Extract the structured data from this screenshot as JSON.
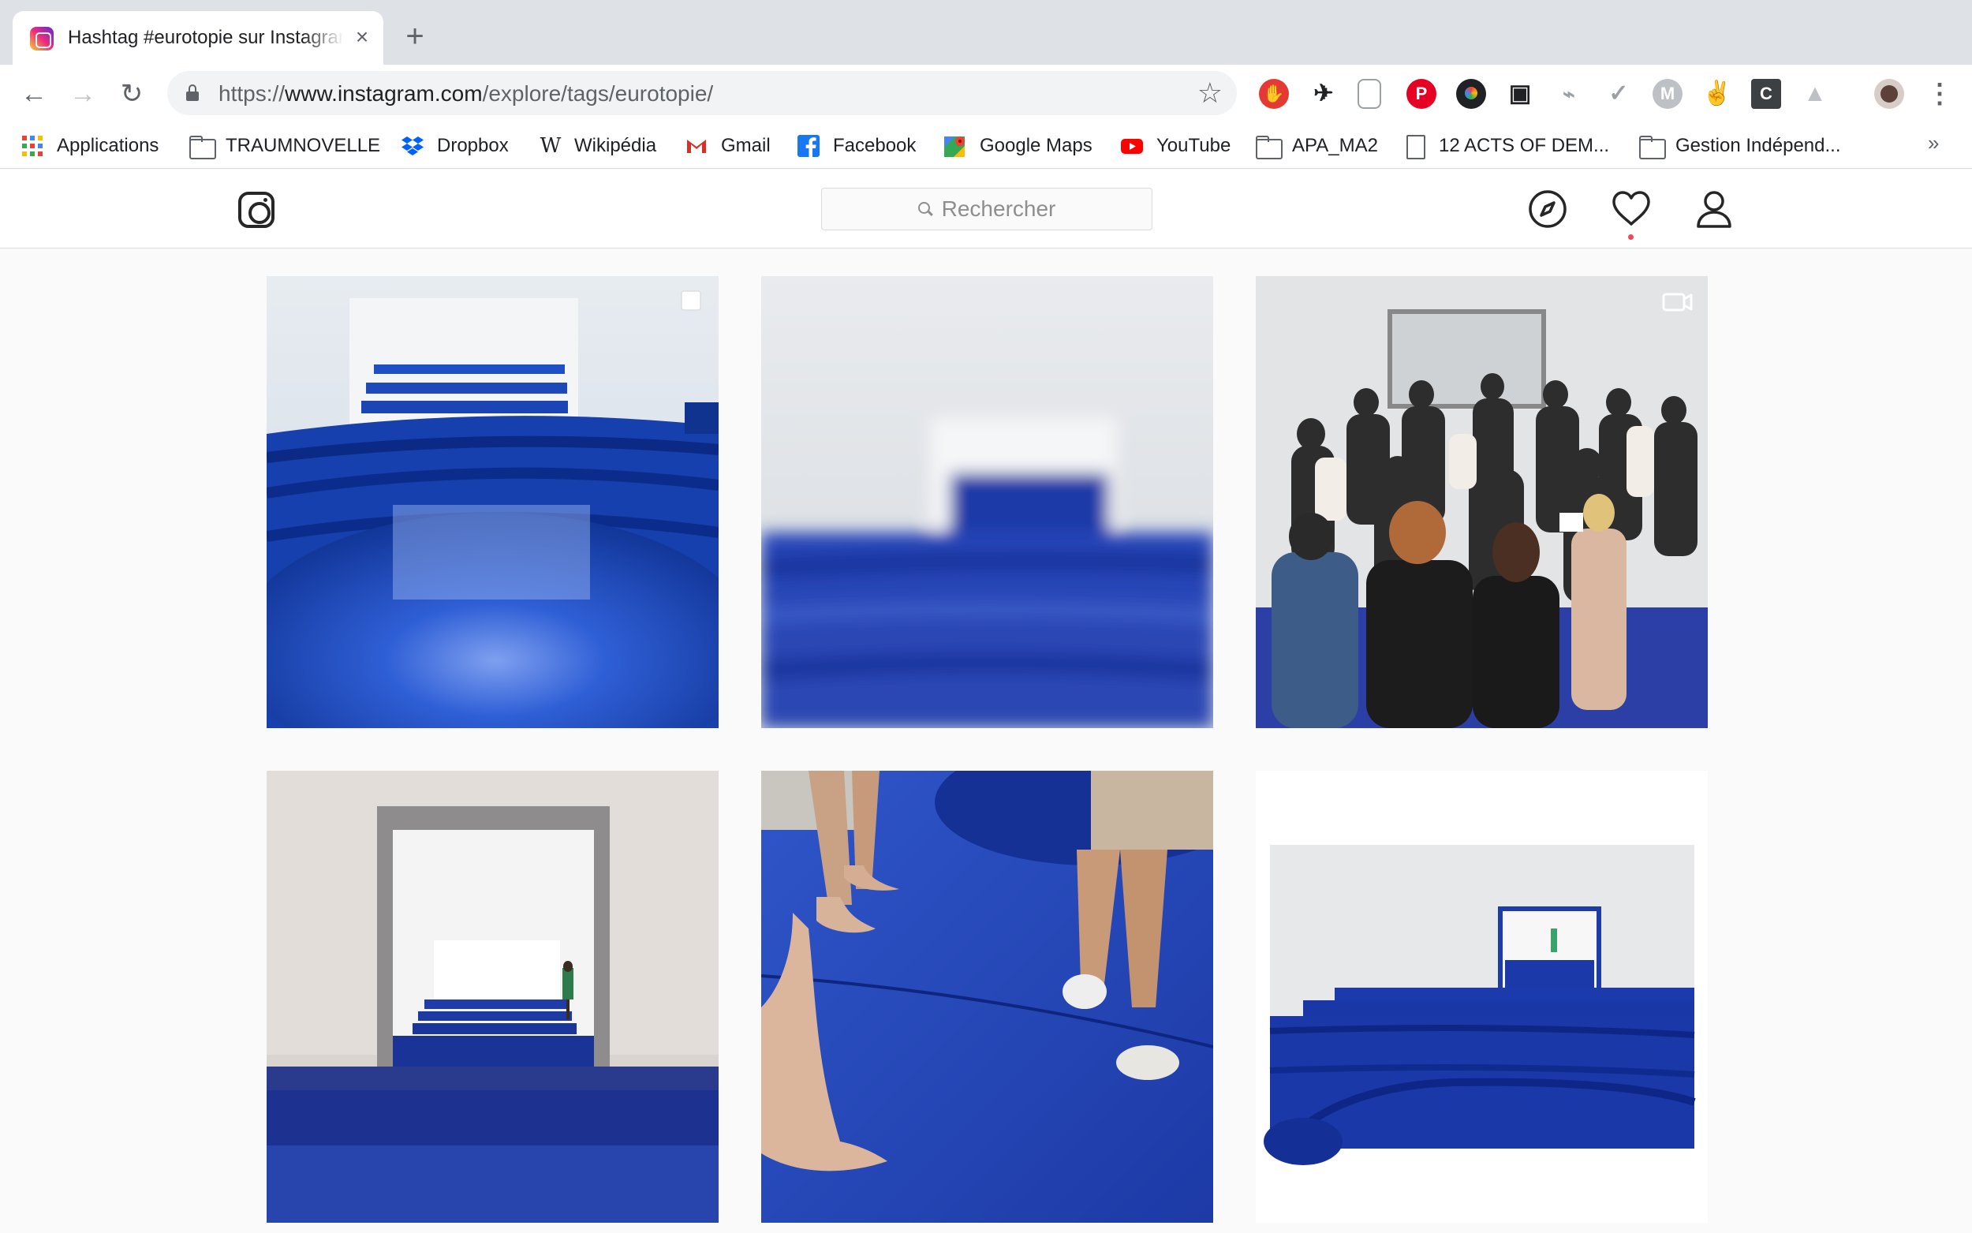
{
  "browser": {
    "tab": {
      "title": "Hashtag #eurotopie sur Instagram",
      "close": "×"
    },
    "new_tab": "+",
    "url": {
      "scheme": "https://",
      "host": "www.instagram.com",
      "path": "/explore/tags/eurotopie/"
    },
    "bookmarks": [
      {
        "label": "Applications",
        "icon": "apps-grid-icon"
      },
      {
        "label": "TRAUMNOVELLE",
        "icon": "folder-icon"
      },
      {
        "label": "Dropbox",
        "icon": "dropbox-icon"
      },
      {
        "label": "Wikipédia",
        "icon": "wikipedia-icon"
      },
      {
        "label": "Gmail",
        "icon": "gmail-icon"
      },
      {
        "label": "Facebook",
        "icon": "facebook-icon"
      },
      {
        "label": "Google Maps",
        "icon": "google-maps-icon"
      },
      {
        "label": "YouTube",
        "icon": "youtube-icon"
      },
      {
        "label": "APA_MA2",
        "icon": "folder-icon"
      },
      {
        "label": "12 ACTS OF DEM...",
        "icon": "document-icon"
      },
      {
        "label": "Gestion Indépend...",
        "icon": "folder-icon"
      }
    ],
    "more_bookmarks": "»"
  },
  "instagram": {
    "search_placeholder": "Rechercher",
    "posts": [
      {
        "kind": "gallery",
        "scene": "blue-amphitheatre"
      },
      {
        "kind": "image",
        "scene": "blurred-blue-steps"
      },
      {
        "kind": "video",
        "scene": "crowd-performance"
      },
      {
        "kind": "image",
        "scene": "doorway-walker"
      },
      {
        "kind": "image",
        "scene": "bare-feet-blue-floor"
      },
      {
        "kind": "image",
        "scene": "landscape-amphitheatre"
      }
    ]
  },
  "colors": {
    "accent_blue": "#1f46b8",
    "notification": "#ed4956"
  }
}
